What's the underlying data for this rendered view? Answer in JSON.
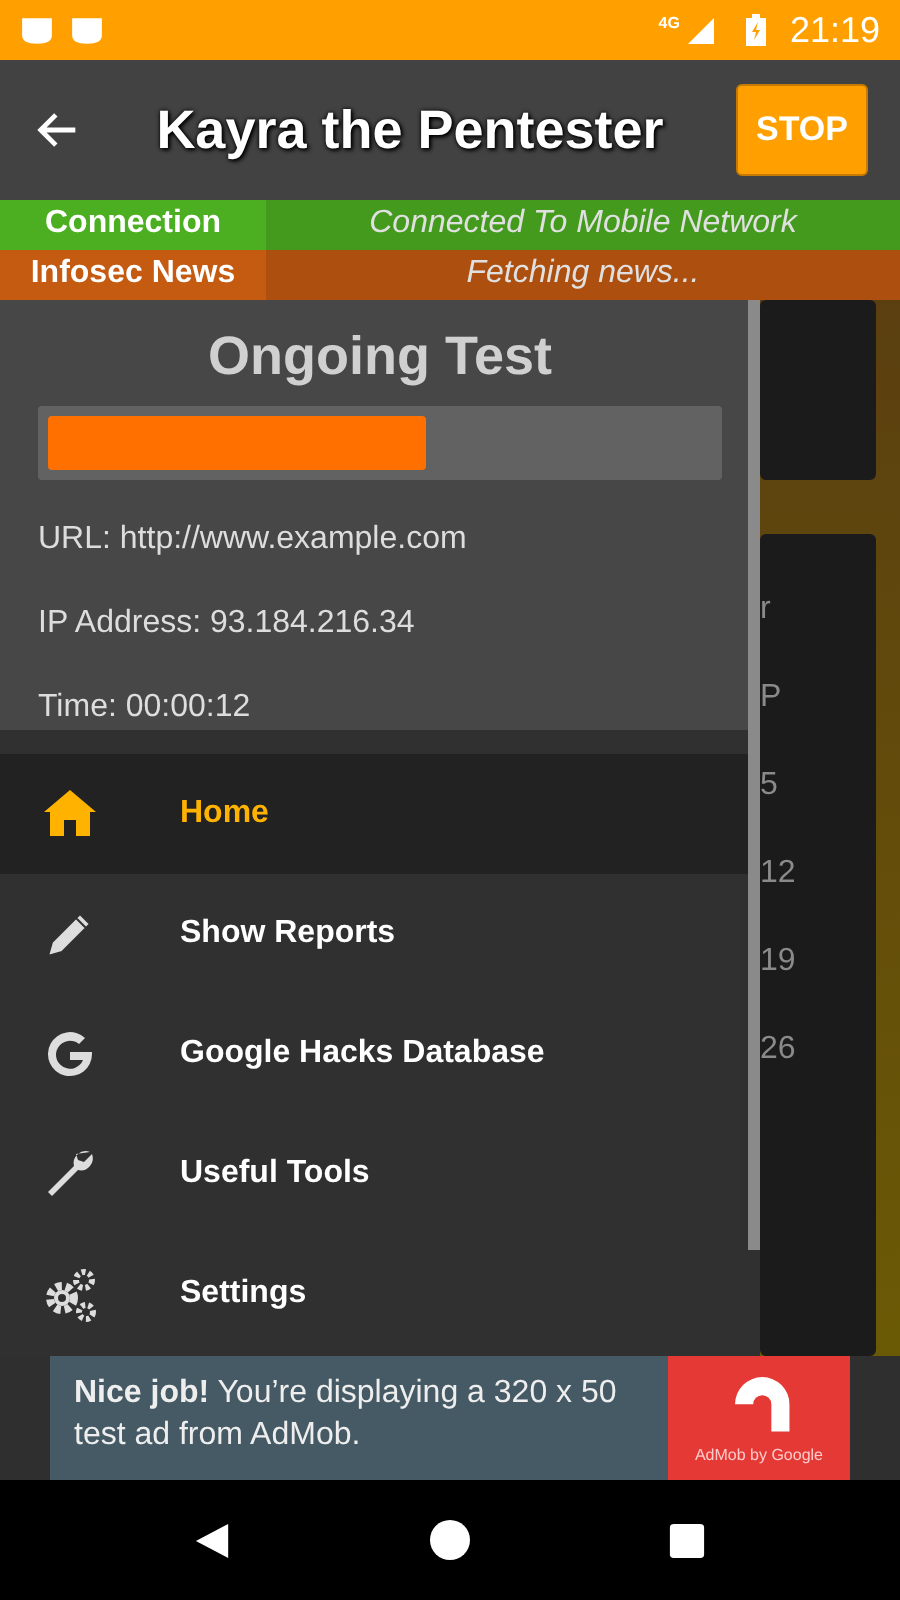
{
  "status_bar": {
    "network": "4G",
    "time": "21:19"
  },
  "toolbar": {
    "title": "Kayra the Pentester",
    "action": "STOP"
  },
  "info_rows": [
    {
      "label": "Connection",
      "value": "Connected To Mobile Network",
      "color": "#4caf21"
    },
    {
      "label": "Infosec News",
      "value": "Fetching news...",
      "color": "#c55a11"
    }
  ],
  "drawer": {
    "header": {
      "title": "Ongoing Test",
      "level": 0.57,
      "lines": [
        "URL: http://www.example.com",
        "IP Address: 93.184.216.34",
        "Time: 00:00:12"
      ]
    },
    "items": [
      {
        "kind": "home",
        "label": "Home",
        "selected": true
      },
      {
        "kind": "reports",
        "label": "Show Reports",
        "selected": false
      },
      {
        "kind": "search",
        "label": "Google Hacks Database",
        "selected": false
      },
      {
        "kind": "tools",
        "label": "Useful Tools",
        "selected": false
      },
      {
        "kind": "settings",
        "label": "Settings",
        "selected": false
      }
    ]
  },
  "background_fragments": [
    "r",
    "P",
    "5",
    "12",
    "19",
    "26"
  ],
  "ad": {
    "text": "**Nice job!** You’re displaying a 320 x 50 test ad from AdMob.",
    "logo_caption": "AdMob by Google"
  }
}
